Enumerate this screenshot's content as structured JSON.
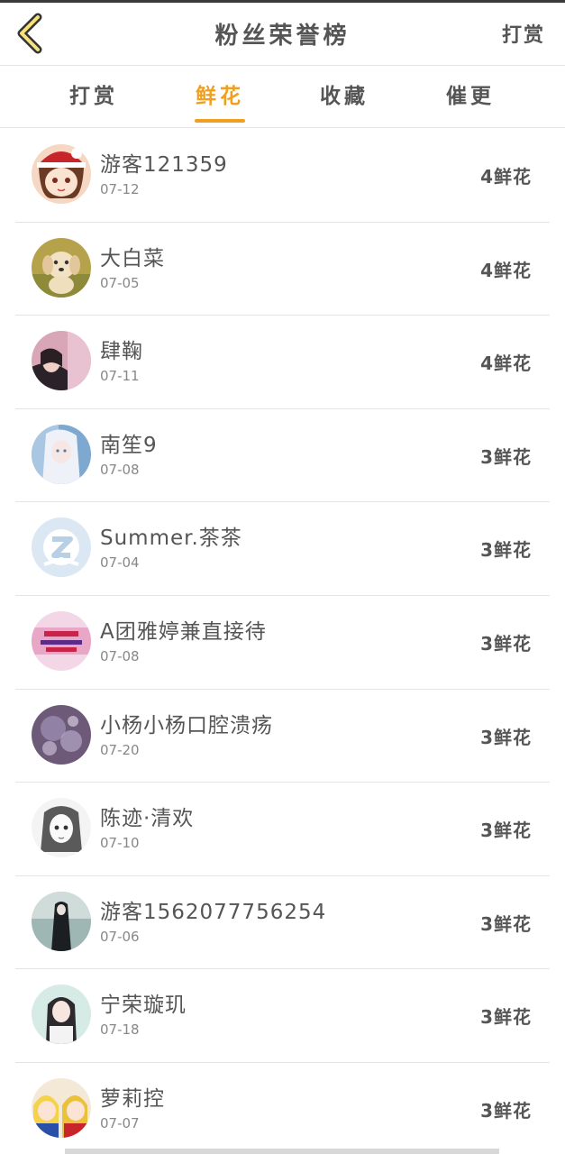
{
  "header": {
    "title": "粉丝荣誉榜",
    "action": "打赏"
  },
  "tabs": [
    {
      "label": "打赏",
      "active": false
    },
    {
      "label": "鲜花",
      "active": true
    },
    {
      "label": "收藏",
      "active": false
    },
    {
      "label": "催更",
      "active": false
    }
  ],
  "colors": {
    "accent": "#f0a020",
    "text": "#555555",
    "divider": "#e4e4e4"
  },
  "list": [
    {
      "name": "游客121359",
      "date": "07-12",
      "amount": "4鲜花",
      "avatar": "avatar-santa-girl"
    },
    {
      "name": "大白菜",
      "date": "07-05",
      "amount": "4鲜花",
      "avatar": "avatar-puppy"
    },
    {
      "name": "肆鞠",
      "date": "07-11",
      "amount": "4鲜花",
      "avatar": "avatar-girl-pink"
    },
    {
      "name": "南笙9",
      "date": "07-08",
      "amount": "3鲜花",
      "avatar": "avatar-anime-white-hair"
    },
    {
      "name": "Summer.茶茶",
      "date": "07-04",
      "amount": "3鲜花",
      "avatar": "avatar-qq-default"
    },
    {
      "name": "A团雅婷兼直接待",
      "date": "07-08",
      "amount": "3鲜花",
      "avatar": "avatar-red-banner"
    },
    {
      "name": "小杨小杨口腔溃疡",
      "date": "07-20",
      "amount": "3鲜花",
      "avatar": "avatar-purple-dream"
    },
    {
      "name": "陈迹·清欢",
      "date": "07-10",
      "amount": "3鲜花",
      "avatar": "avatar-sketch-girl"
    },
    {
      "name": "游客1562077756254",
      "date": "07-06",
      "amount": "3鲜花",
      "avatar": "avatar-dark-figure"
    },
    {
      "name": "宁荣璇玑",
      "date": "07-18",
      "amount": "3鲜花",
      "avatar": "avatar-girl-photo"
    },
    {
      "name": "萝莉控",
      "date": "07-07",
      "amount": "3鲜花",
      "avatar": "avatar-anime-group"
    }
  ]
}
